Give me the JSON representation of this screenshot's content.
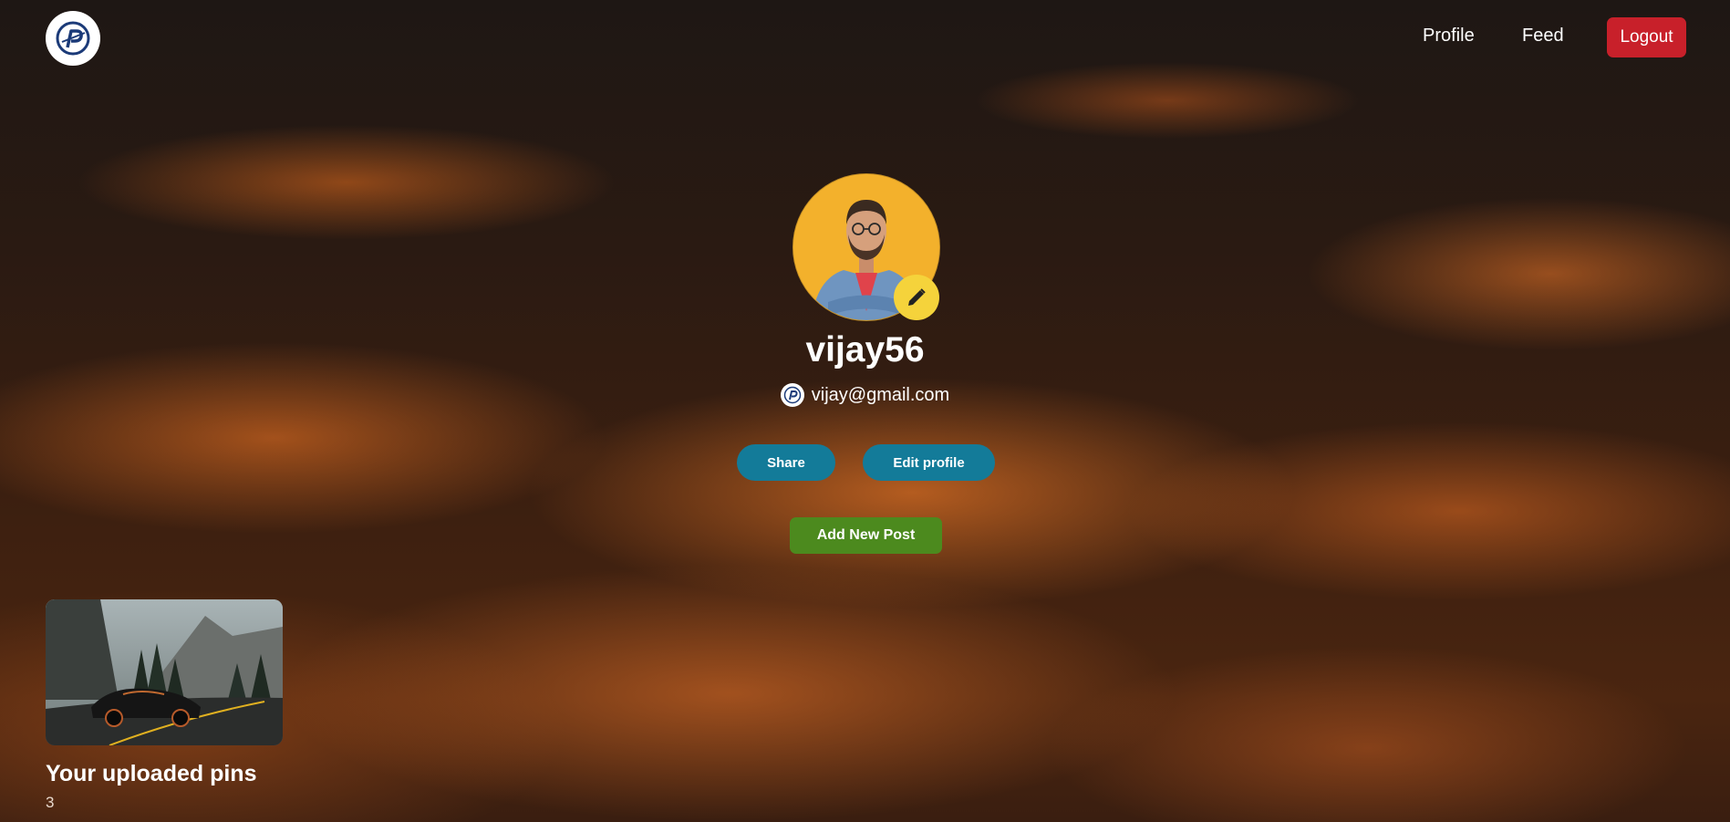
{
  "header": {
    "logo_icon": "pinterest-p-logo-icon",
    "nav": [
      {
        "label": "Profile"
      },
      {
        "label": "Feed"
      }
    ],
    "logout_label": "Logout"
  },
  "profile": {
    "avatar_icon": "user-avatar-photo",
    "edit_avatar_icon": "pencil-icon",
    "username": "vijay56",
    "email_icon": "pinterest-p-logo-icon",
    "email": "vijay@gmail.com",
    "share_label": "Share",
    "edit_profile_label": "Edit profile",
    "add_post_label": "Add New Post"
  },
  "pins": {
    "title": "Your uploaded pins",
    "count": "3",
    "items": [
      {
        "image": "sports-car-mountain-road-image"
      }
    ]
  },
  "colors": {
    "logout_bg": "#c8202a",
    "pill_bg": "#137b99",
    "add_post_bg": "#4c8a1e",
    "edit_avatar_bg": "#f5d33b",
    "avatar_bg": "#f3b12c"
  }
}
